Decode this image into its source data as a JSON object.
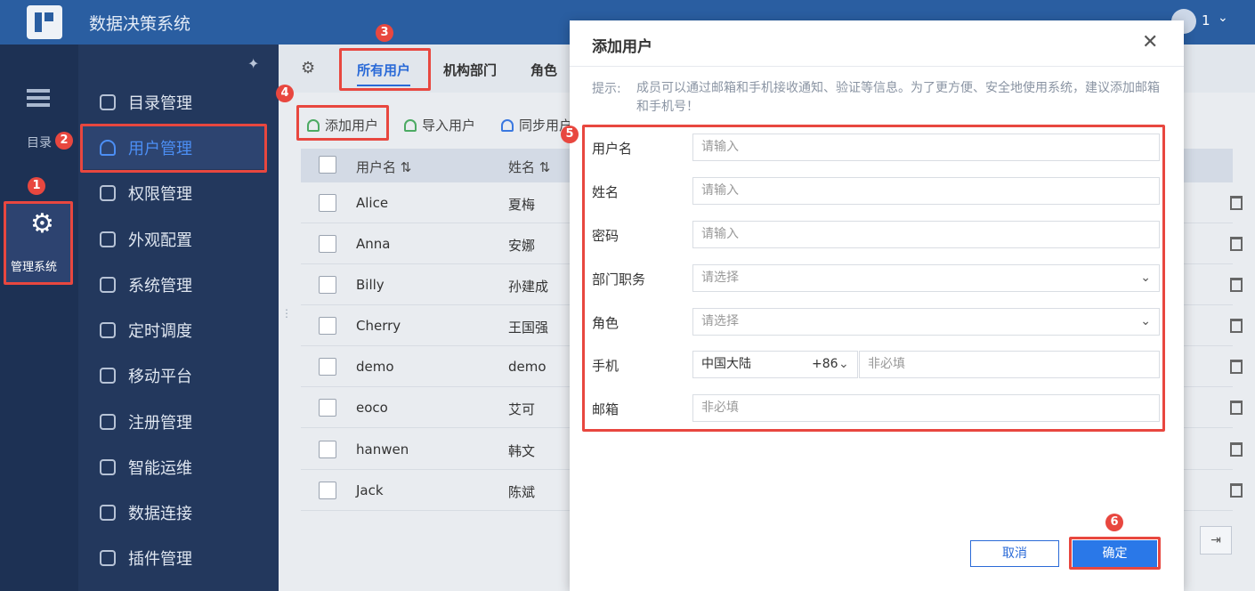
{
  "app": {
    "title": "数据决策系统",
    "user_count": "1"
  },
  "rail": {
    "catalog_label": "目录",
    "admin_label": "管理系统"
  },
  "sidenav": {
    "items": [
      {
        "label": "目录管理"
      },
      {
        "label": "用户管理"
      },
      {
        "label": "权限管理"
      },
      {
        "label": "外观配置"
      },
      {
        "label": "系统管理"
      },
      {
        "label": "定时调度"
      },
      {
        "label": "移动平台"
      },
      {
        "label": "注册管理"
      },
      {
        "label": "智能运维"
      },
      {
        "label": "数据连接"
      },
      {
        "label": "插件管理"
      }
    ]
  },
  "tabs": [
    {
      "label": "所有用户"
    },
    {
      "label": "机构部门"
    },
    {
      "label": "角色"
    }
  ],
  "toolbar": {
    "add_user": "添加用户",
    "import_user": "导入用户",
    "sync_user": "同步用户"
  },
  "table": {
    "columns": {
      "username": "用户名",
      "name": "姓名"
    },
    "rows": [
      {
        "username": "Alice",
        "name": "夏梅"
      },
      {
        "username": "Anna",
        "name": "安娜"
      },
      {
        "username": "Billy",
        "name": "孙建成"
      },
      {
        "username": "Cherry",
        "name": "王国强"
      },
      {
        "username": "demo",
        "name": "demo"
      },
      {
        "username": "eoco",
        "name": "艾可"
      },
      {
        "username": "hanwen",
        "name": "韩文"
      },
      {
        "username": "Jack",
        "name": "陈斌"
      }
    ]
  },
  "dialog": {
    "title": "添加用户",
    "tip_label": "提示:",
    "tip_text": "成员可以通过邮箱和手机接收通知、验证等信息。为了更方便、安全地使用系统，建议添加邮箱和手机号！",
    "fields": {
      "username": {
        "label": "用户名",
        "placeholder": "请输入"
      },
      "name": {
        "label": "姓名",
        "placeholder": "请输入"
      },
      "password": {
        "label": "密码",
        "placeholder": "请输入"
      },
      "department": {
        "label": "部门职务",
        "placeholder": "请选择"
      },
      "role": {
        "label": "角色",
        "placeholder": "请选择"
      },
      "phone": {
        "label": "手机",
        "country": "中国大陆",
        "code": "+86",
        "placeholder": "非必填"
      },
      "email": {
        "label": "邮箱",
        "placeholder": "非必填"
      }
    },
    "cancel": "取消",
    "confirm": "确定"
  },
  "annotations": [
    "1",
    "2",
    "3",
    "4",
    "5",
    "6"
  ],
  "colors": {
    "header": "#2a5ea1",
    "accent": "#2a6ad7",
    "annotation": "#e8473f"
  }
}
